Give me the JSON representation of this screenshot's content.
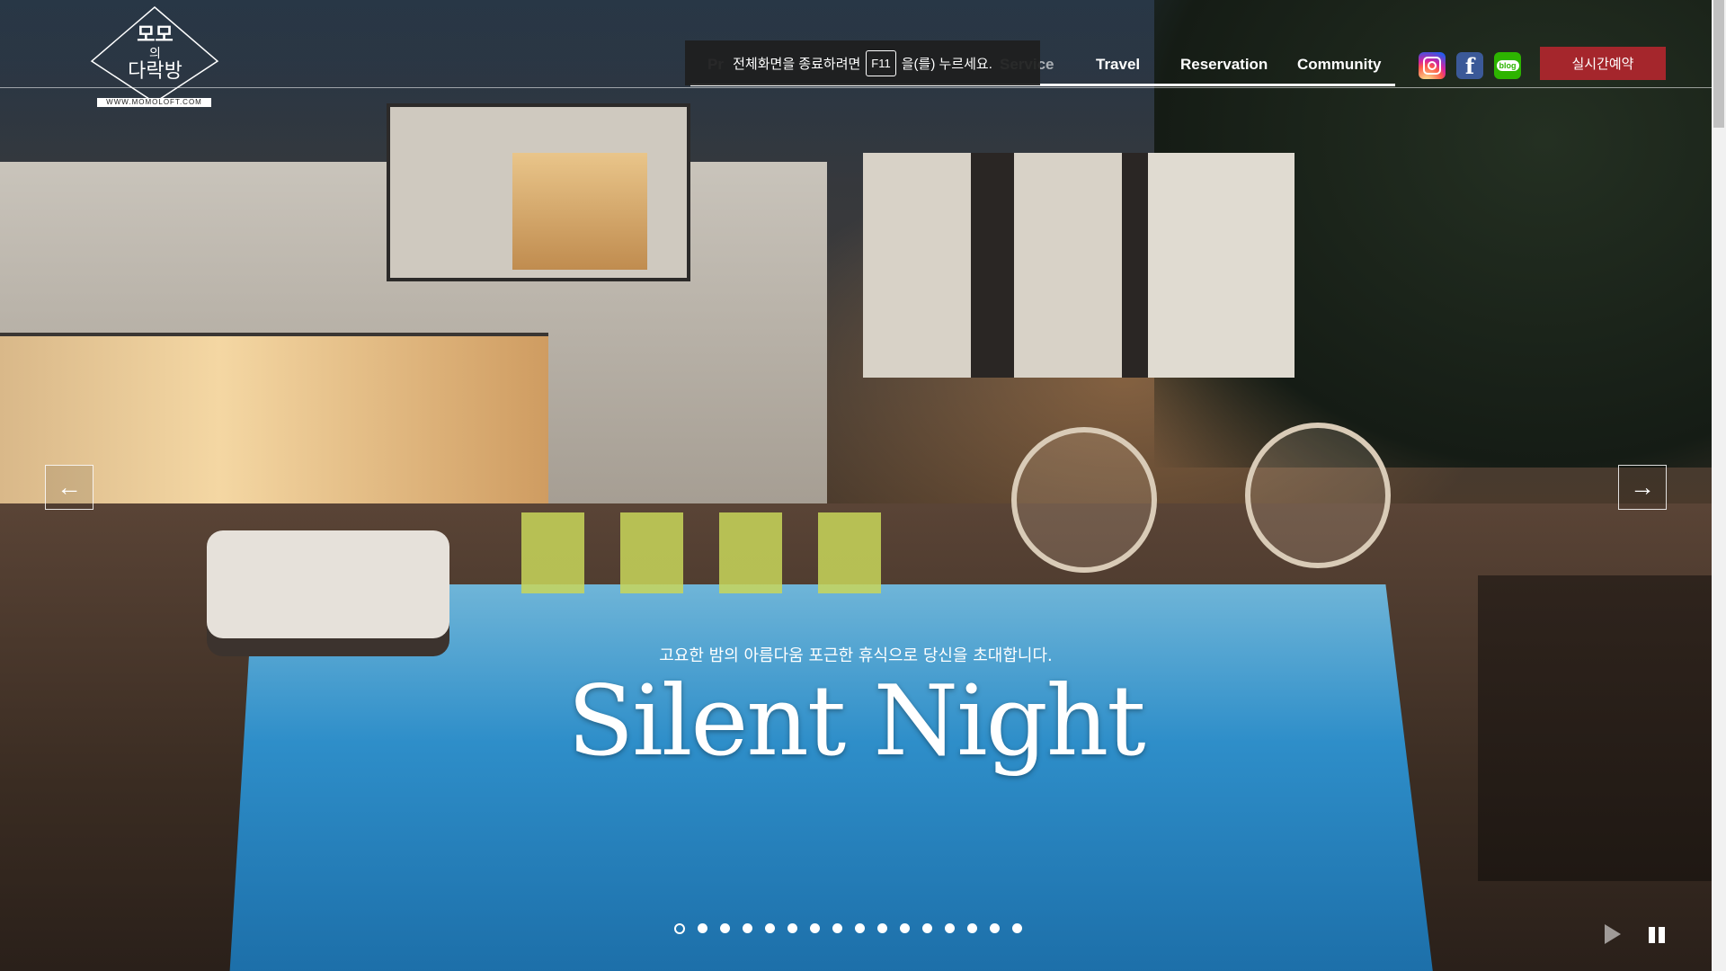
{
  "logo": {
    "line1": "모모",
    "line2": "의",
    "line3": "다락방",
    "url": "WWW.MOMOLOFT.COM"
  },
  "nav": {
    "partial_left": "Pr",
    "partial_service": "Service",
    "travel": "Travel",
    "reservation": "Reservation",
    "community": "Community"
  },
  "fullscreen_notice": {
    "before": "전체화면을 종료하려면",
    "key": "F11",
    "after": "을(를) 누르세요."
  },
  "social": {
    "instagram": "instagram-icon",
    "facebook": "f",
    "blog": "blog"
  },
  "reserve_button": "실시간예약",
  "slide": {
    "subtitle": "고요한 밤의 아름다움 포근한 휴식으로 당신을 초대합니다.",
    "title": "Silent Night"
  },
  "arrows": {
    "prev": "←",
    "next": "→"
  },
  "pagination": {
    "total": 16,
    "active_index": 0
  },
  "colors": {
    "accent": "#a5262c",
    "facebook": "#3b5998",
    "blog": "#2db400"
  }
}
